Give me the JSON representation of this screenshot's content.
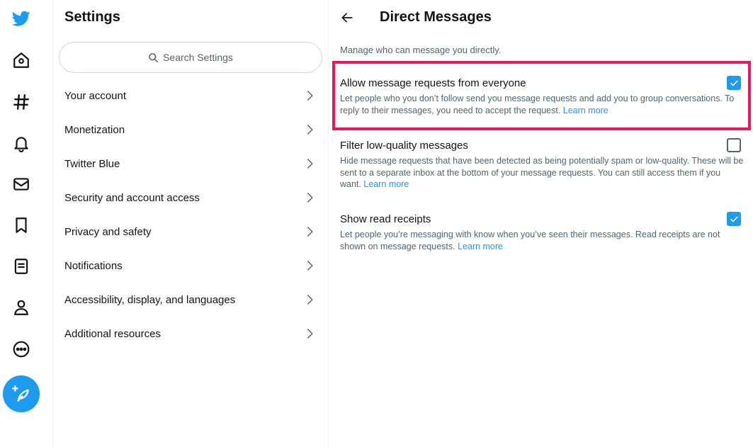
{
  "nav": {
    "icons": [
      "twitter-logo-icon",
      "home-icon",
      "explore-hashtag-icon",
      "notifications-bell-icon",
      "messages-envelope-icon",
      "bookmark-icon",
      "lists-icon",
      "profile-icon",
      "more-icon"
    ],
    "tweet_button_icon": "compose-feather-icon"
  },
  "settings": {
    "title": "Settings",
    "search_placeholder": "Search Settings",
    "items": [
      {
        "label": "Your account"
      },
      {
        "label": "Monetization"
      },
      {
        "label": "Twitter Blue"
      },
      {
        "label": "Security and account access"
      },
      {
        "label": "Privacy and safety"
      },
      {
        "label": "Notifications"
      },
      {
        "label": "Accessibility, display, and languages"
      },
      {
        "label": "Additional resources"
      }
    ]
  },
  "detail": {
    "title": "Direct Messages",
    "description": "Manage who can message you directly.",
    "options": [
      {
        "title": "Allow message requests from everyone",
        "description": "Let people who you don’t follow send you message requests and add you to group conversations. To reply to their messages, you need to accept the request.",
        "link": "Learn more",
        "checked": true,
        "highlighted": true
      },
      {
        "title": "Filter low-quality messages",
        "description": "Hide message requests that have been detected as being potentially spam or low-quality. These will be sent to a separate inbox at the bottom of your message requests. You can still access them if you want.",
        "link": "Learn more",
        "checked": false
      },
      {
        "title": "Show read receipts",
        "description": "Let people you’re messaging with know when you’ve seen their messages. Read receipts are not shown on message requests.",
        "link": "Learn more",
        "checked": true
      }
    ]
  },
  "colors": {
    "accent": "#1d9bf0",
    "highlight_border": "#f0145a",
    "secondary_text": "#536471"
  }
}
